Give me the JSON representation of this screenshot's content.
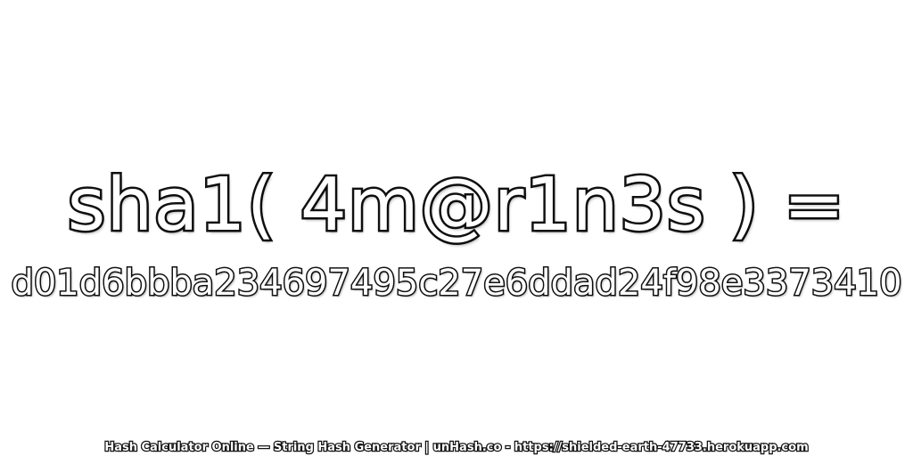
{
  "expression": "sha1( 4m@r1n3s ) =",
  "hash": "d01d6bbba234697495c27e6ddad24f98e3373410",
  "footer": "Hash Calculator Online — String Hash Generator | unHash.co - https://shielded-earth-47733.herokuapp.com",
  "colors": {
    "background": "#ffffff",
    "text_fill": "#ffffff",
    "text_outline": "#111111"
  }
}
